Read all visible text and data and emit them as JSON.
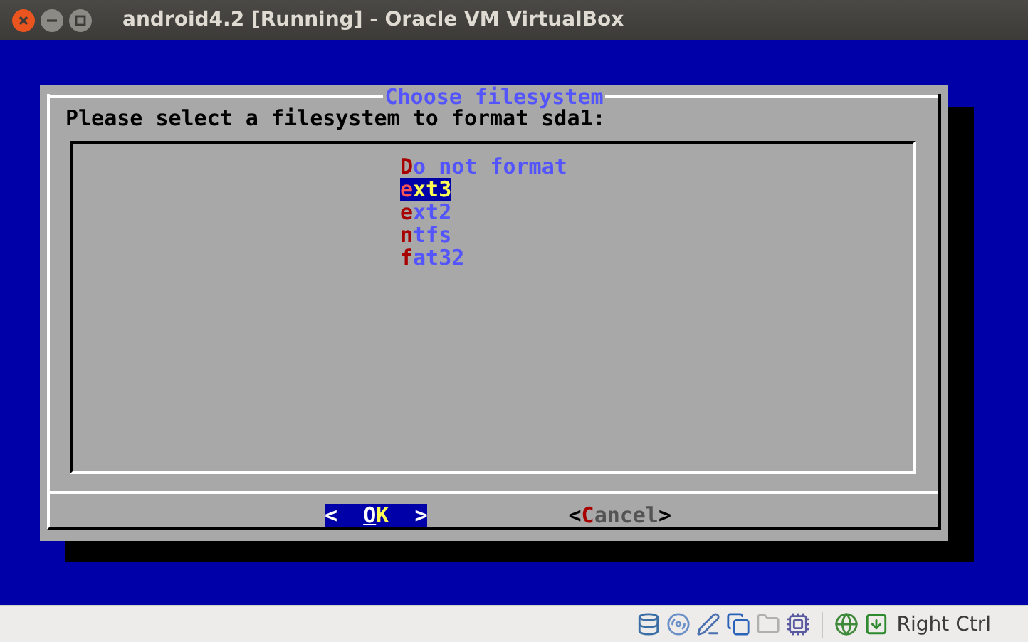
{
  "window": {
    "title": "android4.2 [Running] - Oracle VM VirtualBox"
  },
  "dialog": {
    "title": "Choose filesystem",
    "prompt": "Please select a filesystem to format sda1:",
    "options": [
      {
        "label": "Do not format",
        "selected": false
      },
      {
        "label": "ext3",
        "selected": true
      },
      {
        "label": "ext2",
        "selected": false
      },
      {
        "label": "ntfs",
        "selected": false
      },
      {
        "label": "fat32",
        "selected": false
      }
    ],
    "buttons": [
      {
        "left": "<",
        "label": "OK",
        "right": ">",
        "selected": true
      },
      {
        "left": "<",
        "label": "Cancel",
        "right": ">",
        "selected": false
      }
    ]
  },
  "status_bar": {
    "host_key": "Right Ctrl"
  }
}
